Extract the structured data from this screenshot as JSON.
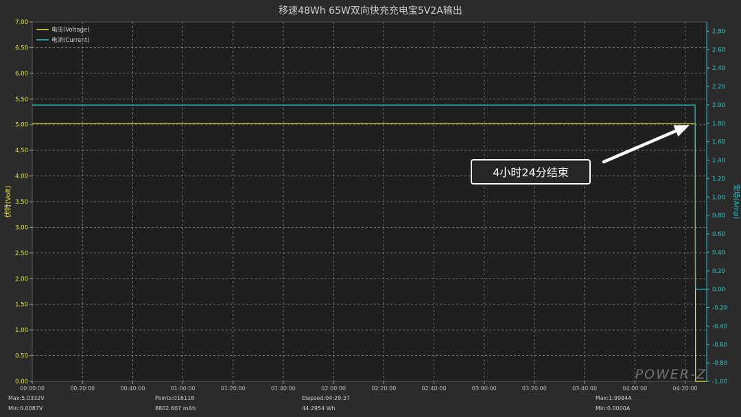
{
  "chart_data": {
    "type": "line",
    "title": "移速48Wh 65W双向快充充电宝5V2A输出",
    "xlabel": "",
    "ylabel_left": "伏特(Volt)",
    "ylabel_right": "安培(Amp)",
    "ylim_left": [
      0,
      7
    ],
    "ylim_right": [
      -1,
      2.9
    ],
    "xlim_seconds": [
      0,
      16117
    ],
    "grid": true,
    "legend_position": "top-left",
    "x_ticks": [
      "00:00:00",
      "00:20:00",
      "00:40:00",
      "01:00:00",
      "01:20:00",
      "01:40:00",
      "02:00:00",
      "02:20:00",
      "02:40:00",
      "03:00:00",
      "03:20:00",
      "03:40:00",
      "04:00:00",
      "04:20:00"
    ],
    "y_left_ticks": [
      "0.00",
      "0.50",
      "1.00",
      "1.50",
      "2.00",
      "2.50",
      "3.00",
      "3.50",
      "4.00",
      "4.50",
      "5.00",
      "5.50",
      "6.00",
      "6.50",
      "7.00"
    ],
    "y_right_ticks": [
      "-1.00",
      "-0.80",
      "-0.60",
      "-0.40",
      "-0.20",
      "0.00",
      "0.20",
      "0.40",
      "0.60",
      "0.80",
      "1.00",
      "1.20",
      "1.40",
      "1.60",
      "1.80",
      "2.00",
      "2.20",
      "2.40",
      "2.60",
      "2.80"
    ],
    "series": [
      {
        "name": "电压(Voltage)",
        "axis": "left",
        "color": "#e8e832",
        "x_hms": [
          "00:00:00",
          "04:24:00",
          "04:24:10",
          "04:28:37"
        ],
        "values": [
          5.02,
          5.02,
          0.0,
          0.0
        ]
      },
      {
        "name": "电流(Current)",
        "axis": "right",
        "color": "#2bc9c9",
        "x_hms": [
          "00:00:00",
          "04:24:00",
          "04:24:10",
          "04:28:37"
        ],
        "values": [
          1.9984,
          1.9984,
          0.0,
          0.0
        ]
      }
    ],
    "annotation": {
      "text": "4小时24分结束",
      "points_to_hms": "04:24:00",
      "points_to_value": 5.02
    },
    "watermark": "POWER-Z"
  },
  "stats": {
    "max_voltage": "Max:5.0332V",
    "min_voltage": "Min:0.0087V",
    "points": "Points:016118",
    "capacity": "8802.607 mAh",
    "elapsed": "Elapsed:04:28:37",
    "energy": "44.2954 Wh",
    "max_current": "Max:1.9984A",
    "min_current": "Min:0.0000A"
  }
}
